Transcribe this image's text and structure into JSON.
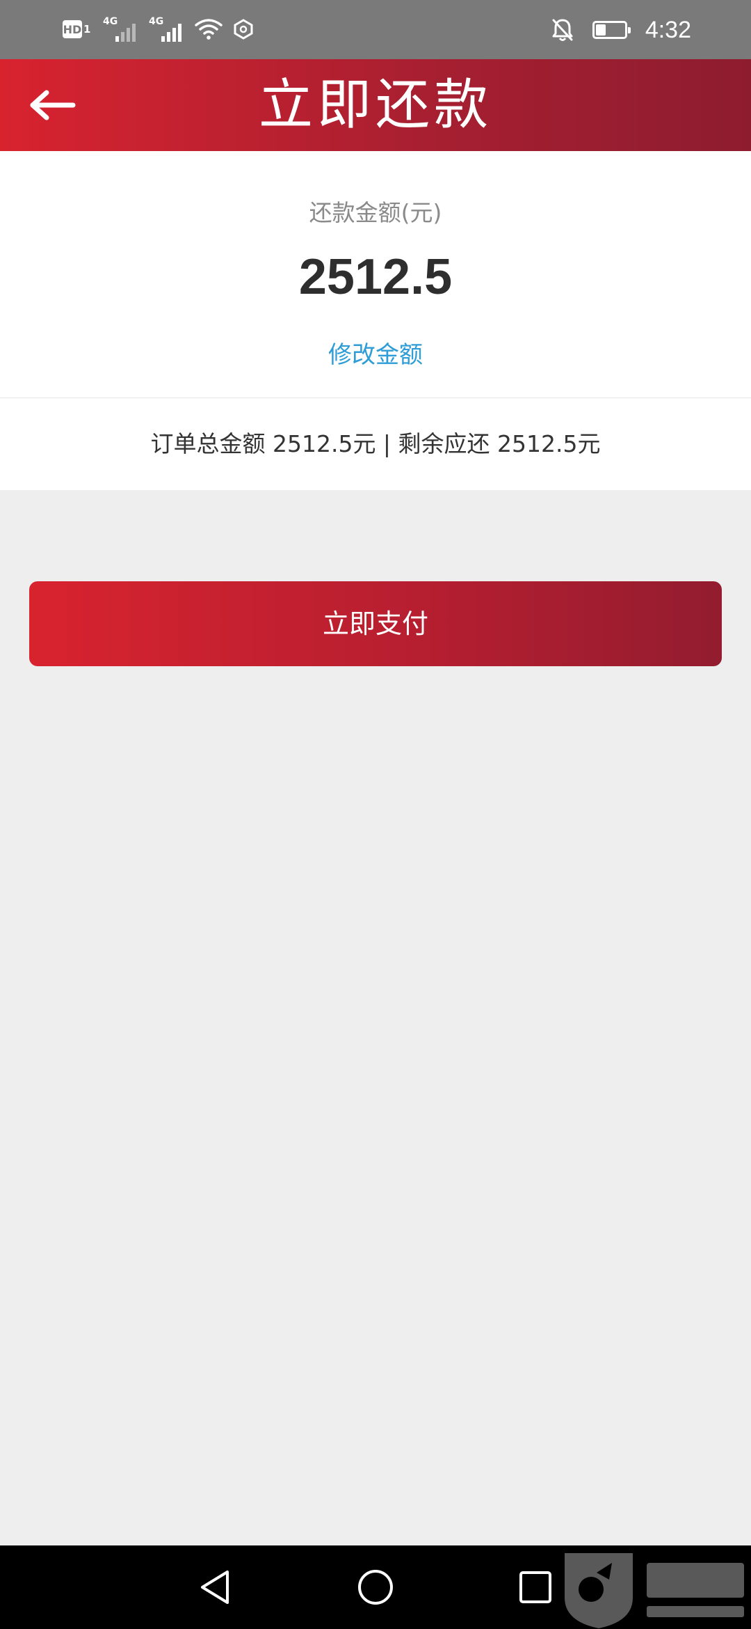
{
  "status_bar": {
    "hd_label": "HD",
    "hd_sub": "1",
    "network_1": "4G",
    "network_2": "4G",
    "battery_level": 0.35,
    "time": "4:32",
    "icons": [
      "hd-icon",
      "signal-icon",
      "wifi-icon",
      "nfc-icon",
      "mute-bell-icon",
      "battery-icon"
    ]
  },
  "header": {
    "title": "立即还款",
    "back_icon": "back-arrow-icon"
  },
  "amount": {
    "label": "还款金额(元)",
    "value": "2512.5",
    "edit_label": "修改金额"
  },
  "summary": {
    "text": "订单总金额 2512.5元 | 剩余应还 2512.5元"
  },
  "actions": {
    "pay_label": "立即支付"
  },
  "nav": {
    "icons": [
      "back-triangle-icon",
      "home-circle-icon",
      "recents-square-icon"
    ]
  },
  "colors": {
    "brand_red": "#D8232F",
    "brand_dark": "#8E1C2F",
    "link_blue": "#2E9CD6",
    "page_bg": "#EEEEEE",
    "status_bar": "#7A7A7A"
  }
}
